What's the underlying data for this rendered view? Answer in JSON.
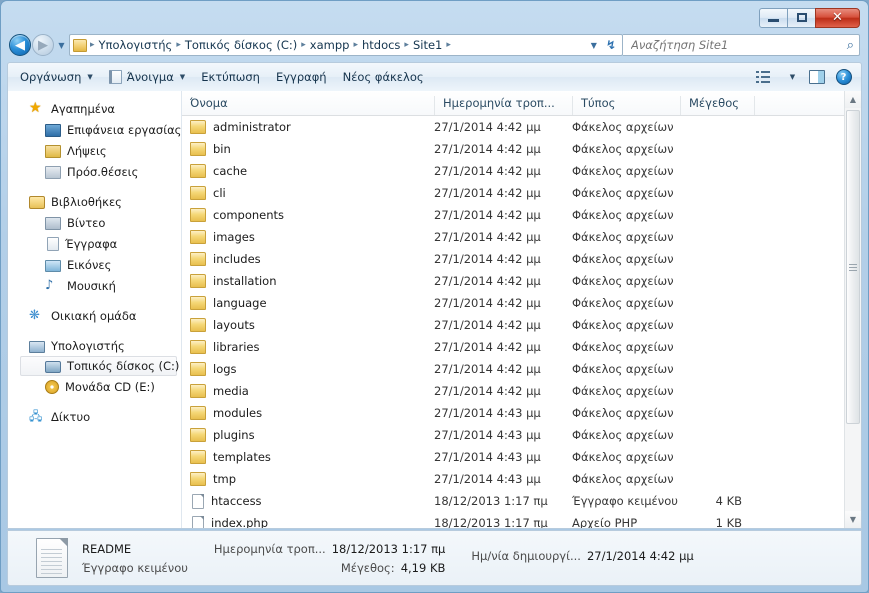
{
  "window": {
    "buttons": {
      "minimize": "–",
      "restore": "❐",
      "close": "✕"
    }
  },
  "nav": {
    "back_icon": "◀",
    "forward_icon": "▶",
    "history_caret": "▼",
    "breadcrumb": [
      "Υπολογιστής",
      "Τοπικός δίσκος (C:)",
      "xampp",
      "htdocs",
      "Site1"
    ],
    "separator": "▸",
    "dropdown_caret": "▼",
    "refresh_icon": "↯"
  },
  "search": {
    "placeholder": "Αναζήτηση Site1",
    "value": "",
    "icon": "⌕"
  },
  "toolbar": {
    "organize": "Οργάνωση",
    "open": "Άνοιγμα",
    "print": "Εκτύπωση",
    "burn": "Εγγραφή",
    "new_folder": "Νέος φάκελος",
    "caret": "▼",
    "help_glyph": "?"
  },
  "sidebar": {
    "groups": [
      {
        "header": {
          "label": "Αγαπημένα",
          "icon": "star-icon"
        },
        "items": [
          {
            "label": "Επιφάνεια εργασίας",
            "icon": "desktop-icon"
          },
          {
            "label": "Λήψεις",
            "icon": "downloads-icon"
          },
          {
            "label": "Πρόσ.θέσεις",
            "icon": "recent-places-icon"
          }
        ]
      },
      {
        "header": {
          "label": "Βιβλιοθήκες",
          "icon": "libraries-icon"
        },
        "items": [
          {
            "label": "Βίντεο",
            "icon": "video-icon"
          },
          {
            "label": "Έγγραφα",
            "icon": "documents-icon"
          },
          {
            "label": "Εικόνες",
            "icon": "pictures-icon"
          },
          {
            "label": "Μουσική",
            "icon": "music-icon"
          }
        ]
      },
      {
        "header": {
          "label": "Οικιακή ομάδα",
          "icon": "homegroup-icon"
        },
        "items": []
      },
      {
        "header": {
          "label": "Υπολογιστής",
          "icon": "computer-icon"
        },
        "items": [
          {
            "label": "Τοπικός δίσκος (C:)",
            "icon": "local-disk-icon",
            "selected": true
          },
          {
            "label": "Μονάδα CD (E:)",
            "icon": "cd-drive-icon"
          }
        ]
      },
      {
        "header": {
          "label": "Δίκτυο",
          "icon": "network-icon"
        },
        "items": []
      }
    ]
  },
  "columns": [
    {
      "label": "Όνομα",
      "sorted": "asc"
    },
    {
      "label": "Ημερομηνία τροπ...",
      "sorted": ""
    },
    {
      "label": "Τύπος",
      "sorted": ""
    },
    {
      "label": "Μέγεθος",
      "sorted": ""
    }
  ],
  "files": [
    {
      "name": "administrator",
      "date": "27/1/2014 4:42 μμ",
      "type": "Φάκελος αρχείων",
      "size": "",
      "icon": "folder-icon"
    },
    {
      "name": "bin",
      "date": "27/1/2014 4:42 μμ",
      "type": "Φάκελος αρχείων",
      "size": "",
      "icon": "folder-icon"
    },
    {
      "name": "cache",
      "date": "27/1/2014 4:42 μμ",
      "type": "Φάκελος αρχείων",
      "size": "",
      "icon": "folder-icon"
    },
    {
      "name": "cli",
      "date": "27/1/2014 4:42 μμ",
      "type": "Φάκελος αρχείων",
      "size": "",
      "icon": "folder-icon"
    },
    {
      "name": "components",
      "date": "27/1/2014 4:42 μμ",
      "type": "Φάκελος αρχείων",
      "size": "",
      "icon": "folder-icon"
    },
    {
      "name": "images",
      "date": "27/1/2014 4:42 μμ",
      "type": "Φάκελος αρχείων",
      "size": "",
      "icon": "folder-icon"
    },
    {
      "name": "includes",
      "date": "27/1/2014 4:42 μμ",
      "type": "Φάκελος αρχείων",
      "size": "",
      "icon": "folder-icon"
    },
    {
      "name": "installation",
      "date": "27/1/2014 4:42 μμ",
      "type": "Φάκελος αρχείων",
      "size": "",
      "icon": "folder-icon"
    },
    {
      "name": "language",
      "date": "27/1/2014 4:42 μμ",
      "type": "Φάκελος αρχείων",
      "size": "",
      "icon": "folder-icon"
    },
    {
      "name": "layouts",
      "date": "27/1/2014 4:42 μμ",
      "type": "Φάκελος αρχείων",
      "size": "",
      "icon": "folder-icon"
    },
    {
      "name": "libraries",
      "date": "27/1/2014 4:42 μμ",
      "type": "Φάκελος αρχείων",
      "size": "",
      "icon": "folder-icon"
    },
    {
      "name": "logs",
      "date": "27/1/2014 4:42 μμ",
      "type": "Φάκελος αρχείων",
      "size": "",
      "icon": "folder-icon"
    },
    {
      "name": "media",
      "date": "27/1/2014 4:42 μμ",
      "type": "Φάκελος αρχείων",
      "size": "",
      "icon": "folder-icon"
    },
    {
      "name": "modules",
      "date": "27/1/2014 4:43 μμ",
      "type": "Φάκελος αρχείων",
      "size": "",
      "icon": "folder-icon"
    },
    {
      "name": "plugins",
      "date": "27/1/2014 4:43 μμ",
      "type": "Φάκελος αρχείων",
      "size": "",
      "icon": "folder-icon"
    },
    {
      "name": "templates",
      "date": "27/1/2014 4:43 μμ",
      "type": "Φάκελος αρχείων",
      "size": "",
      "icon": "folder-icon"
    },
    {
      "name": "tmp",
      "date": "27/1/2014 4:43 μμ",
      "type": "Φάκελος αρχείων",
      "size": "",
      "icon": "folder-icon"
    },
    {
      "name": "htaccess",
      "date": "18/12/2013 1:17 πμ",
      "type": "Έγγραφο κειμένου",
      "size": "4 KB",
      "icon": "text-file-icon"
    },
    {
      "name": "index.php",
      "date": "18/12/2013 1:17 πμ",
      "type": "Αρχείο PHP",
      "size": "1 KB",
      "icon": "php-file-icon"
    }
  ],
  "scrollbar": {
    "up": "▲",
    "down": "▼"
  },
  "details": {
    "name": "README",
    "type": "Έγγραφο κειμένου",
    "modified_label": "Ημερομηνία τροπ...",
    "modified_value": "18/12/2013 1:17 πμ",
    "size_label": "Μέγεθος:",
    "size_value": "4,19 KB",
    "created_label": "Ημ/νία δημιουργί...",
    "created_value": "27/1/2014 4:42 μμ"
  }
}
